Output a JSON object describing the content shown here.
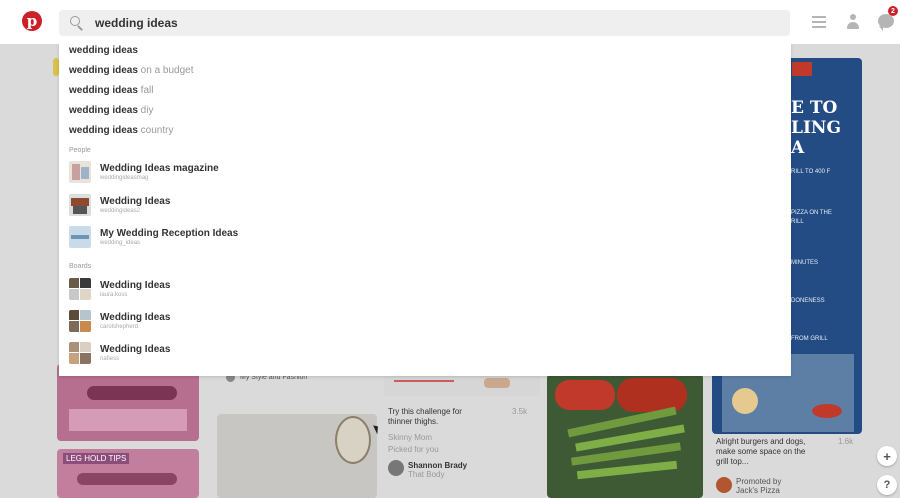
{
  "search": {
    "value": "wedding ideas",
    "placeholder": ""
  },
  "header": {
    "notif_count": "2"
  },
  "suggestions": [
    {
      "bold": "wedding ideas",
      "rest": ""
    },
    {
      "bold": "wedding ideas",
      "rest": " on a budget"
    },
    {
      "bold": "wedding ideas",
      "rest": " fall"
    },
    {
      "bold": "wedding ideas",
      "rest": " diy"
    },
    {
      "bold": "wedding ideas",
      "rest": " country"
    }
  ],
  "sections": {
    "people": "People",
    "boards": "Boards"
  },
  "people": [
    {
      "name": "Wedding Ideas magazine",
      "handle": "weddingideasmag"
    },
    {
      "name": "Wedding Ideas",
      "handle": "weddingideas2"
    },
    {
      "name": "My Wedding Reception Ideas",
      "handle": "wedding_ideas"
    }
  ],
  "boards": [
    {
      "name": "Wedding Ideas",
      "owner": "laura.koss"
    },
    {
      "name": "Wedding Ideas",
      "owner": "carolshepherd"
    },
    {
      "name": "Wedding Ideas",
      "owner": "nafiess"
    }
  ],
  "background": {
    "yoga_pin_label": "LEG HOLD TIPS",
    "style_fashion": "My Style and Fashion",
    "pin_challenge_title": "Try this challenge for thinner thighs.",
    "pin_challenge_saves": "3.5k",
    "pin_challenge_sub1": "Skinny Mom",
    "pin_challenge_sub2": "Picked for you",
    "pin_challenge_user": "Shannon Brady",
    "pin_challenge_board": "That Body",
    "ad_title_lines": [
      "E TO",
      "LING",
      "A"
    ],
    "ad_small1": "RILL TO 400 F",
    "ad_small2": "PIZZA ON THE",
    "ad_small3": "RILL",
    "ad_small4": "MINUTES",
    "ad_small5": "DONENESS",
    "ad_small6": "FROM GRILL",
    "pizza_pin_title": "Alright burgers and dogs, make some space on the grill top...",
    "pizza_pin_saves": "1.6k",
    "pizza_promoted": "Promoted by",
    "pizza_brand": "Jack's Pizza"
  },
  "buttons": {
    "plus": "+",
    "help": "?"
  },
  "colors": {
    "brand_red": "#cb2027",
    "overlay_gray": "#dadada"
  }
}
